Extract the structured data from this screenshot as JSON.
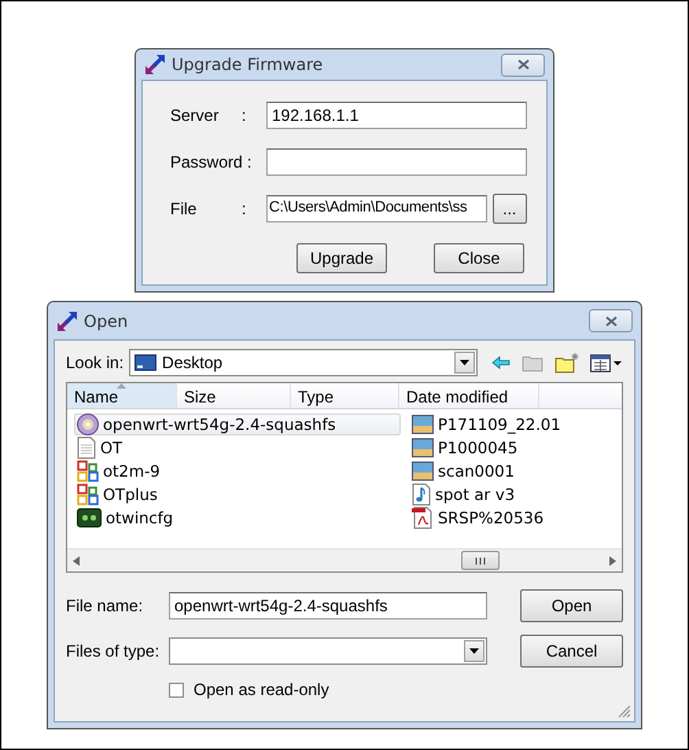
{
  "upgrade_dialog": {
    "title": "Upgrade Firmware",
    "fields": [
      {
        "label": "Server",
        "colon": ":",
        "value": "192.168.1.1"
      },
      {
        "label": "Password :"
      },
      {
        "label": "File",
        "colon": ":",
        "value": "C:\\Users\\Admin\\Documents\\ss",
        "browse": "..."
      }
    ],
    "buttons": [
      "Upgrade",
      "Close"
    ]
  },
  "open_dialog": {
    "title": "Open",
    "look_in": {
      "label": "Look in:",
      "value": "Desktop"
    },
    "columns": [
      "Name",
      "Size",
      "Type",
      "Date modified"
    ],
    "files": [
      {
        "name": "openwrt-wrt54g-2.4-squashfs",
        "kind": "disc",
        "selected": true
      },
      {
        "name": "OT",
        "kind": "text",
        "selected": false
      },
      {
        "name": "ot2m-9",
        "kind": "app",
        "selected": false
      },
      {
        "name": "OTplus",
        "kind": "app",
        "selected": false
      },
      {
        "name": "otwincfg",
        "kind": "program",
        "selected": false
      },
      {
        "name": "P171109_22.01",
        "kind": "image",
        "selected": false
      },
      {
        "name": "P1000045",
        "kind": "image",
        "selected": false
      },
      {
        "name": "scan0001",
        "kind": "image",
        "selected": false
      },
      {
        "name": "spot ar v3",
        "kind": "audio",
        "selected": false
      },
      {
        "name": "SRSP%20536",
        "kind": "pdf",
        "selected": false
      }
    ],
    "file_name": {
      "label": "File name:",
      "value": "openwrt-wrt54g-2.4-squashfs"
    },
    "file_type": {
      "label": "Files of type:"
    },
    "read_only": {
      "label": "Open as read-only",
      "checked": false
    },
    "buttons": [
      "Open",
      "Cancel"
    ]
  }
}
